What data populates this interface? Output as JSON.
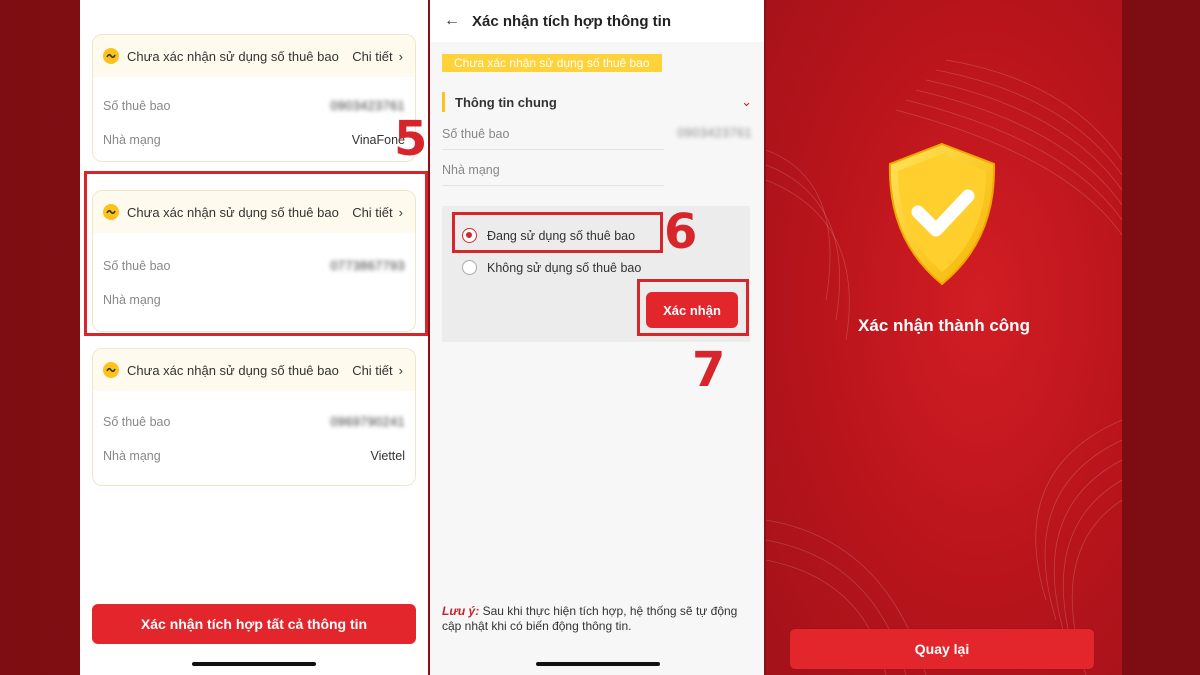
{
  "panel1": {
    "cards": [
      {
        "title": "Chưa xác nhận sử dụng số thuê bao",
        "detail": "Chi tiết",
        "subscriber_label": "Số thuê bao",
        "subscriber_value": "0903423761",
        "carrier_label": "Nhà mạng",
        "carrier_value": "VinaFone"
      },
      {
        "title": "Chưa xác nhận sử dụng số thuê bao",
        "detail": "Chi tiết",
        "subscriber_label": "Số thuê bao",
        "subscriber_value": "0773867793",
        "carrier_label": "Nhà mạng",
        "carrier_value": ""
      },
      {
        "title": "Chưa xác nhận sử dụng số thuê bao",
        "detail": "Chi tiết",
        "subscriber_label": "Số thuê bao",
        "subscriber_value": "0969790241",
        "carrier_label": "Nhà mạng",
        "carrier_value": "Viettel"
      }
    ],
    "confirm_all_button": "Xác nhận tích hợp tất cả thông tin"
  },
  "panel2": {
    "header_title": "Xác nhận tích hợp thông tin",
    "status_tag": "Chưa xác nhận sử dụng số thuê bao",
    "section_title": "Thông tin chung",
    "subscriber_label": "Số thuê bao",
    "subscriber_value": "0903423761",
    "carrier_label": "Nhà mạng",
    "options": [
      "Đang sử dụng số thuê bao",
      "Không sử dụng số thuê bao"
    ],
    "selected_option": 0,
    "confirm_button": "Xác nhận",
    "note_label": "Lưu ý:",
    "note_text": " Sau khi thực hiện tích hợp, hệ thống sẽ tự động cập nhật khi có biến động thông tin."
  },
  "panel3": {
    "success_text": "Xác nhận thành công",
    "back_button": "Quay lại"
  },
  "steps": {
    "s5": "5",
    "s6": "6",
    "s7": "7"
  },
  "colors": {
    "brand_red": "#e3262c",
    "highlight_red": "#d7262b",
    "warning_yellow": "#ffc21a",
    "shield_yellow": "#ffcf2e"
  },
  "icons": {
    "warning": "warning-circle-icon",
    "back": "arrow-left-icon",
    "chevron": "chevron-right-icon",
    "collapse": "chevron-down-icon",
    "shield": "shield-check-icon"
  }
}
